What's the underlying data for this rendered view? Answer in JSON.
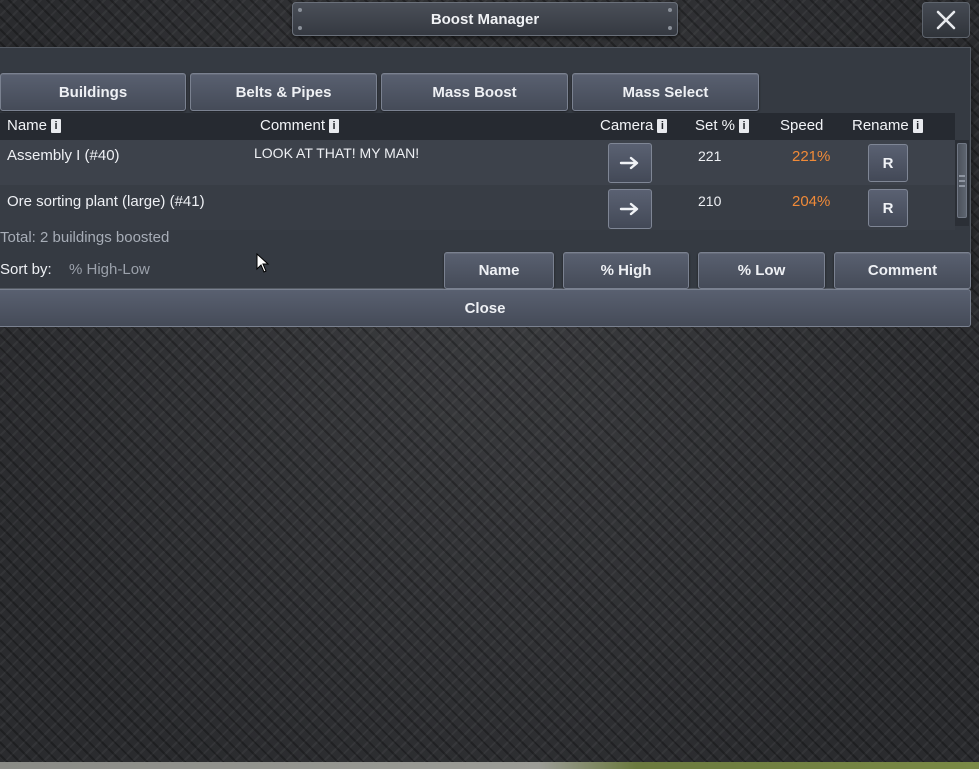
{
  "window": {
    "title": "Boost Manager"
  },
  "tabs": [
    {
      "label": "Buildings"
    },
    {
      "label": "Belts & Pipes"
    },
    {
      "label": "Mass Boost"
    },
    {
      "label": "Mass Select"
    }
  ],
  "columns": {
    "name": "Name",
    "comment": "Comment",
    "camera": "Camera",
    "set_pct": "Set %",
    "speed": "Speed",
    "rename": "Rename",
    "info_glyph": "i"
  },
  "rows": [
    {
      "name": "Assembly I (#40)",
      "comment": "LOOK AT THAT! MY MAN!",
      "camera_icon": "arrow-right-icon",
      "set_pct": "221",
      "speed": "221%",
      "rename_label": "R"
    },
    {
      "name": "Ore sorting plant (large) (#41)",
      "comment": "",
      "camera_icon": "arrow-right-icon",
      "set_pct": "210",
      "speed": "204%",
      "rename_label": "R"
    }
  ],
  "summary": {
    "total_text": "Total: 2 buildings boosted"
  },
  "sort": {
    "label": "Sort by:",
    "value": "% High-Low",
    "buttons": [
      {
        "label": "Name"
      },
      {
        "label": "% High"
      },
      {
        "label": "% Low"
      },
      {
        "label": "Comment"
      }
    ]
  },
  "footer": {
    "close_label": "Close"
  },
  "colors": {
    "speed": "#f08a38",
    "panel": "#353a42",
    "button": "#4f5664"
  }
}
